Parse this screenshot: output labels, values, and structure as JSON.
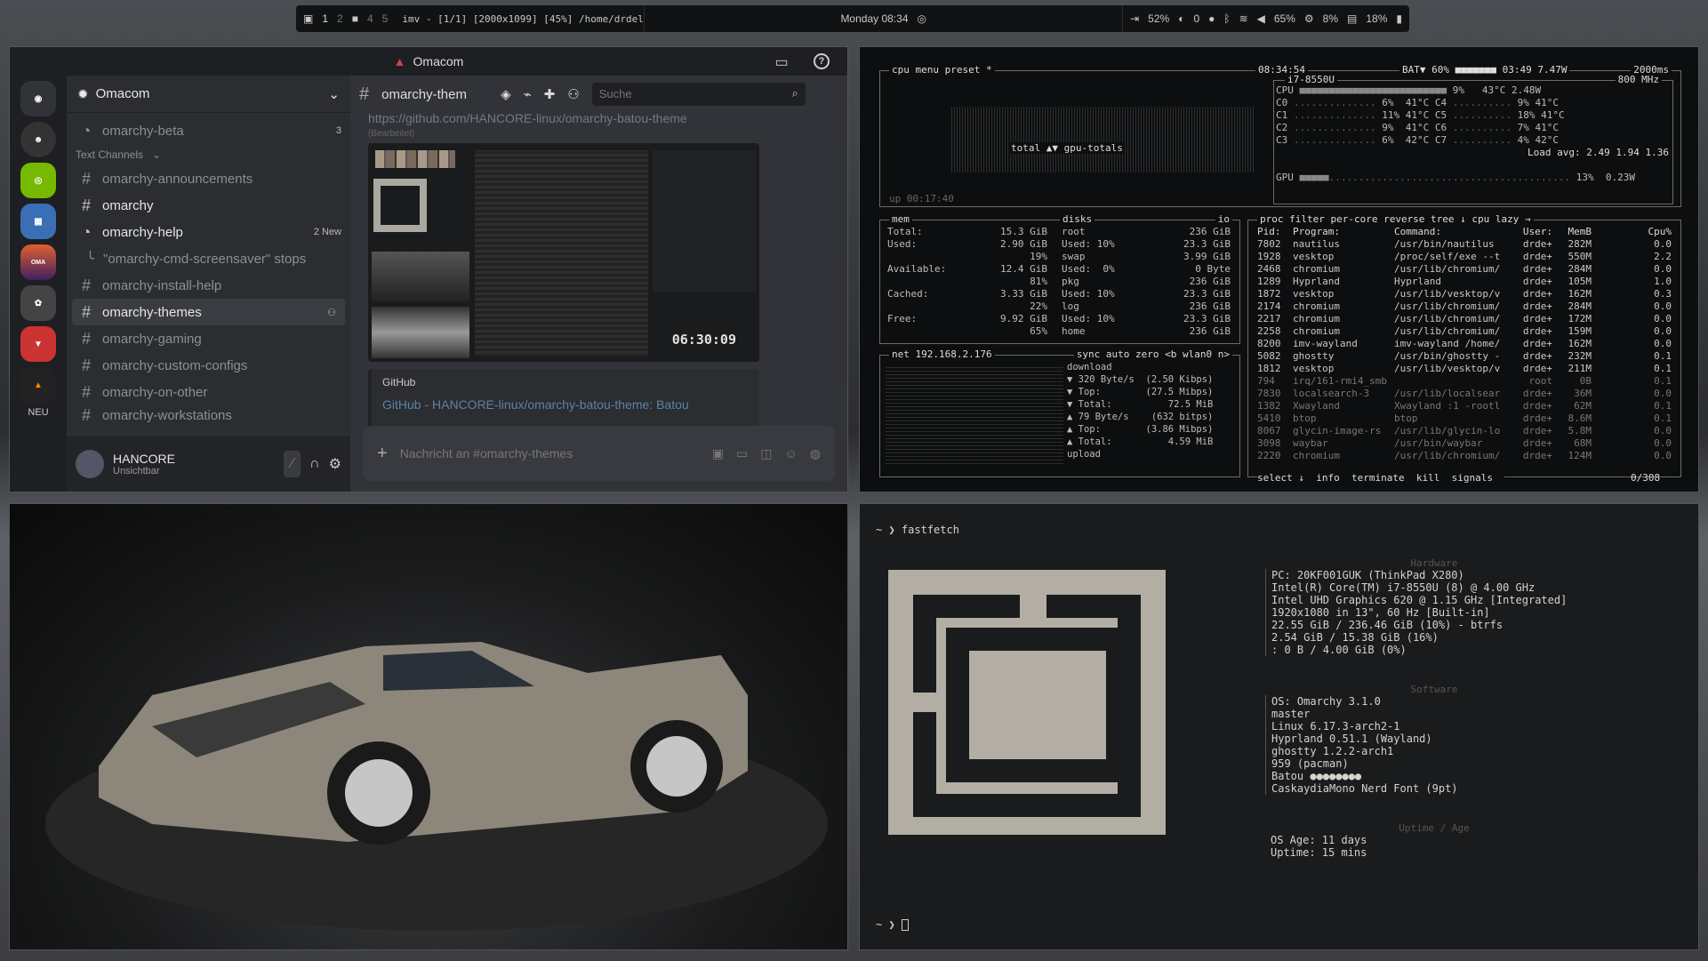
{
  "topbar": {
    "workspaces": [
      "1",
      "2",
      "4",
      "5"
    ],
    "active_window": "imv - [1/1] [2000x1099] [45%] /home/drdeltree...",
    "clock": "Monday 08:34",
    "battery_pct": "52%",
    "notif_count": "0",
    "volume": "65%",
    "cpu": "8%",
    "mem": "18%"
  },
  "discord": {
    "title": "Omacom",
    "server_name": "Omacom",
    "guild_new_label": "NEU",
    "channels": [
      {
        "name": "omarchy-beta",
        "type": "thread",
        "badge": "3"
      },
      {
        "name": "Text Channels",
        "type": "category"
      },
      {
        "name": "omarchy-announcements",
        "type": "text"
      },
      {
        "name": "omarchy",
        "type": "text"
      },
      {
        "name": "omarchy-help",
        "type": "forum",
        "badge": "2 New"
      },
      {
        "name": "\"omarchy-cmd-screensaver\" stops",
        "type": "subthread"
      },
      {
        "name": "omarchy-install-help",
        "type": "text"
      },
      {
        "name": "omarchy-themes",
        "type": "text"
      },
      {
        "name": "omarchy-gaming",
        "type": "text"
      },
      {
        "name": "omarchy-custom-configs",
        "type": "text"
      },
      {
        "name": "omarchy-on-other",
        "type": "text"
      },
      {
        "name": "omarchy-workstations",
        "type": "text"
      }
    ],
    "chat_channel": "omarchy-them",
    "search_placeholder": "Suche",
    "link_text": "https://github.com/HANCORE-linux/omarchy-batou-theme",
    "edited_label": "(Bearbeitet)",
    "preview_time": "06:30:09",
    "embed_provider": "GitHub",
    "embed_title": "GitHub - HANCORE-linux/omarchy-batou-theme: Batou",
    "message_placeholder": "Nachricht an #omarchy-themes",
    "user_name": "HANCORE",
    "user_status": "Unsichtbar"
  },
  "btop": {
    "cpu_header": [
      "cpu",
      "menu",
      "preset",
      "*"
    ],
    "time": "08:34:54",
    "battery": "BAT▼ 60%",
    "battery_time": "03:49",
    "power": "7.47W",
    "interval": "2000ms",
    "cpu_model": "i7-8550U",
    "cpu_freq": "800 MHz",
    "cpu_total": "9%",
    "cpu_temp": "43°C",
    "cpu_watt": "2.48W",
    "cores": [
      {
        "l": "C0",
        "p": "6%",
        "t": "41°C",
        "r": "C4",
        "rp": "9%",
        "rt": "41°C"
      },
      {
        "l": "C1",
        "p": "11%",
        "t": "41°C",
        "r": "C5",
        "rp": "18%",
        "rt": "41°C"
      },
      {
        "l": "C2",
        "p": "9%",
        "t": "41°C",
        "r": "C6",
        "rp": "7%",
        "rt": "41°C"
      },
      {
        "l": "C3",
        "p": "6%",
        "t": "42°C",
        "r": "C7",
        "rp": "4%",
        "rt": "42°C"
      }
    ],
    "load_avg": "Load avg: 2.49 1.94 1.36",
    "gpu_line": "13%  0.23W",
    "graph_label": "total ▲▼ gpu-totals",
    "uptime": "up 00:17:40",
    "mem_rows": [
      [
        "Total:",
        "15.3 GiB"
      ],
      [
        "Used:",
        "2.90 GiB"
      ],
      [
        "",
        "19%"
      ],
      [
        "Available:",
        "12.4 GiB"
      ],
      [
        "",
        "81%"
      ],
      [
        "Cached:",
        "3.33 GiB"
      ],
      [
        "",
        "22%"
      ],
      [
        "Free:",
        "9.92 GiB"
      ],
      [
        "",
        "65%"
      ]
    ],
    "disk_rows": [
      [
        "root",
        "236 GiB"
      ],
      [
        "Used: 10%",
        "23.3 GiB"
      ],
      [
        "swap",
        "3.99 GiB"
      ],
      [
        "Used:  0%",
        "0 Byte"
      ],
      [
        "pkg",
        "236 GiB"
      ],
      [
        "Used: 10%",
        "23.3 GiB"
      ],
      [
        "log",
        "236 GiB"
      ],
      [
        "Used: 10%",
        "23.3 GiB"
      ],
      [
        "home",
        "236 GiB"
      ]
    ],
    "net_title": "net 192.168.2.176",
    "net_opts": "sync auto zero <b wlan0 n>",
    "net_rows": [
      "download",
      "▼ 320 Byte/s  (2.50 Kibps)",
      "▼ Top:        (27.5 Mibps)",
      "▼ Total:          72.5 MiB",
      "▲ 79 Byte/s    (632 bitps)",
      "▲ Top:        (3.86 Mibps)",
      "▲ Total:          4.59 MiB",
      "upload"
    ],
    "proc_header": [
      "Pid:",
      "Program:",
      "Command:",
      "User:",
      "MemB",
      "Cpu%"
    ],
    "procs": [
      [
        "7802",
        "nautilus",
        "/usr/bin/nautilus",
        "drde+",
        "282M",
        "0.0"
      ],
      [
        "1928",
        "vesktop",
        "/proc/self/exe --t",
        "drde+",
        "550M",
        "2.2"
      ],
      [
        "2468",
        "chromium",
        "/usr/lib/chromium/",
        "drde+",
        "284M",
        "0.0"
      ],
      [
        "1289",
        "Hyprland",
        "Hyprland",
        "drde+",
        "105M",
        "1.0"
      ],
      [
        "1872",
        "vesktop",
        "/usr/lib/vesktop/v",
        "drde+",
        "162M",
        "0.3"
      ],
      [
        "2174",
        "chromium",
        "/usr/lib/chromium/",
        "drde+",
        "284M",
        "0.0"
      ],
      [
        "2217",
        "chromium",
        "/usr/lib/chromium/",
        "drde+",
        "172M",
        "0.0"
      ],
      [
        "2258",
        "chromium",
        "/usr/lib/chromium/",
        "drde+",
        "159M",
        "0.0"
      ],
      [
        "8200",
        "imv-wayland",
        "imv-wayland /home/",
        "drde+",
        "162M",
        "0.0"
      ],
      [
        "5082",
        "ghostty",
        "/usr/bin/ghostty -",
        "drde+",
        "232M",
        "0.1"
      ],
      [
        "1812",
        "vesktop",
        "/usr/lib/vesktop/v",
        "drde+",
        "211M",
        "0.1"
      ],
      [
        "794",
        "irq/161-rmi4_smb",
        "",
        "root",
        "0B",
        "0.1"
      ],
      [
        "7830",
        "localsearch-3",
        "/usr/lib/localsear",
        "drde+",
        "36M",
        "0.0"
      ],
      [
        "1382",
        "Xwayland",
        "Xwayland :1 -rootl",
        "drde+",
        "62M",
        "0.1"
      ],
      [
        "5410",
        "btop",
        "btop",
        "drde+",
        "8.6M",
        "0.1"
      ],
      [
        "8067",
        "glycin-image-rs",
        "/usr/lib/glycin-lo",
        "drde+",
        "5.8M",
        "0.0"
      ],
      [
        "3098",
        "waybar",
        "/usr/bin/waybar",
        "drde+",
        "68M",
        "0.0"
      ],
      [
        "2220",
        "chromium",
        "/usr/lib/chromium/",
        "drde+",
        "124M",
        "0.0"
      ]
    ],
    "proc_footer": [
      "select ↓",
      "info",
      "terminate",
      "kill",
      "signals",
      "0/308"
    ],
    "proc_opts": "proc filter  per-core reverse tree ↓ cpu lazy →"
  },
  "fastfetch": {
    "prompt_cmd": "fastfetch",
    "prompt": "~ ❯",
    "sections": {
      "hardware": "Hardware",
      "software": "Software",
      "uptime": "Uptime / Age"
    },
    "hardware": [
      "PC: 20KF001GUK (ThinkPad X280)",
      "Intel(R) Core(TM) i7-8550U (8) @ 4.00 GHz",
      "Intel UHD Graphics 620 @ 1.15 GHz [Integrated]",
      "1920x1080 in 13\", 60 Hz [Built-in]",
      "22.55 GiB / 236.46 GiB (10%) - btrfs",
      "2.54 GiB / 15.38 GiB (16%)",
      ": 0 B / 4.00 GiB (0%)"
    ],
    "software": [
      "OS: Omarchy 3.1.0",
      "master",
      "Linux 6.17.3-arch2-1",
      "Hyprland 0.51.1 (Wayland)",
      "ghostty 1.2.2-arch1",
      "959 (pacman)",
      "Batou ●●●●●●●●",
      "CaskaydiaMono Nerd Font (9pt)"
    ],
    "uptime": [
      "OS Age: 11 days",
      "Uptime: 15 mins"
    ]
  }
}
